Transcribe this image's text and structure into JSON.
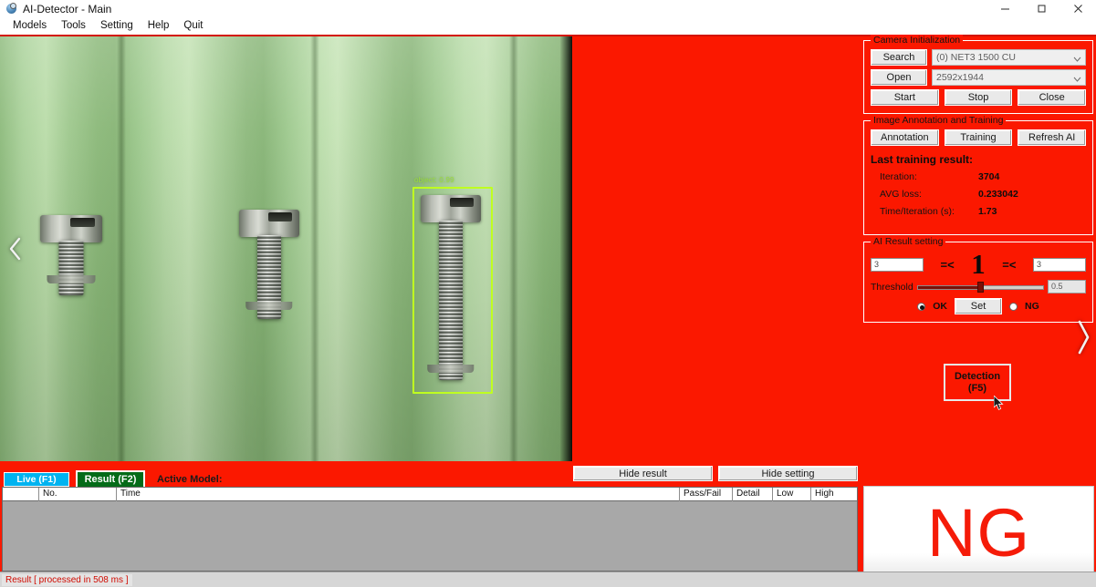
{
  "window": {
    "title": "AI-Detector - Main",
    "icon": "camera-globe-icon",
    "minimize": "minimize-icon",
    "maximize": "maximize-icon",
    "close": "close-icon"
  },
  "menu": {
    "items": [
      "Models",
      "Tools",
      "Setting",
      "Help",
      "Quit"
    ]
  },
  "image_view": {
    "detection_label": "object: 0.99",
    "prev_arrow": "chevron-left-icon",
    "next_arrow": "chevron-right-icon"
  },
  "camera": {
    "group_title": "Camera Initialization",
    "search_label": "Search",
    "open_label": "Open",
    "device_value": "(0) NET3 1500 CU",
    "resolution_value": "2592x1944",
    "start_label": "Start",
    "stop_label": "Stop",
    "close_label": "Close"
  },
  "annotation": {
    "group_title": "Image Annotation and Training",
    "annotation_label": "Annotation",
    "training_label": "Training",
    "refresh_label": "Refresh AI",
    "result_title": "Last training result:",
    "rows": [
      {
        "label": "Iteration:",
        "value": "3704"
      },
      {
        "label": "AVG loss:",
        "value": "0.233042"
      },
      {
        "label": "Time/Iteration (s):",
        "value": "1.73"
      }
    ]
  },
  "ai_result": {
    "group_title": "AI Result setting",
    "low_value": "3",
    "high_value": "3",
    "op_left": "=<",
    "op_right": "=<",
    "count": "1",
    "threshold_label": "Threshold",
    "threshold_value": "0.5",
    "threshold_percent": 50,
    "ok_label": "OK",
    "ng_label": "NG",
    "set_label": "Set",
    "selected": "OK"
  },
  "detection": {
    "line1": "Detection",
    "line2": "(F5)"
  },
  "toolbar": {
    "live_label": "Live (F1)",
    "result_label": "Result (F2)",
    "active_model_label": "Active Model:",
    "hide_result_label": "Hide result",
    "hide_setting_label": "Hide setting"
  },
  "table": {
    "columns": [
      "",
      "No.",
      "Time",
      "Pass/Fail",
      "Detail",
      "Low",
      "High"
    ],
    "rows": []
  },
  "verdict": {
    "text": "NG"
  },
  "status": {
    "text": "Result [ processed in 508 ms ]"
  },
  "colors": {
    "app_background": "#fb1800",
    "live_button": "#00b3f0",
    "result_button": "#046b18",
    "verdict": "#f51b08",
    "detection_box": "#bfff20"
  }
}
